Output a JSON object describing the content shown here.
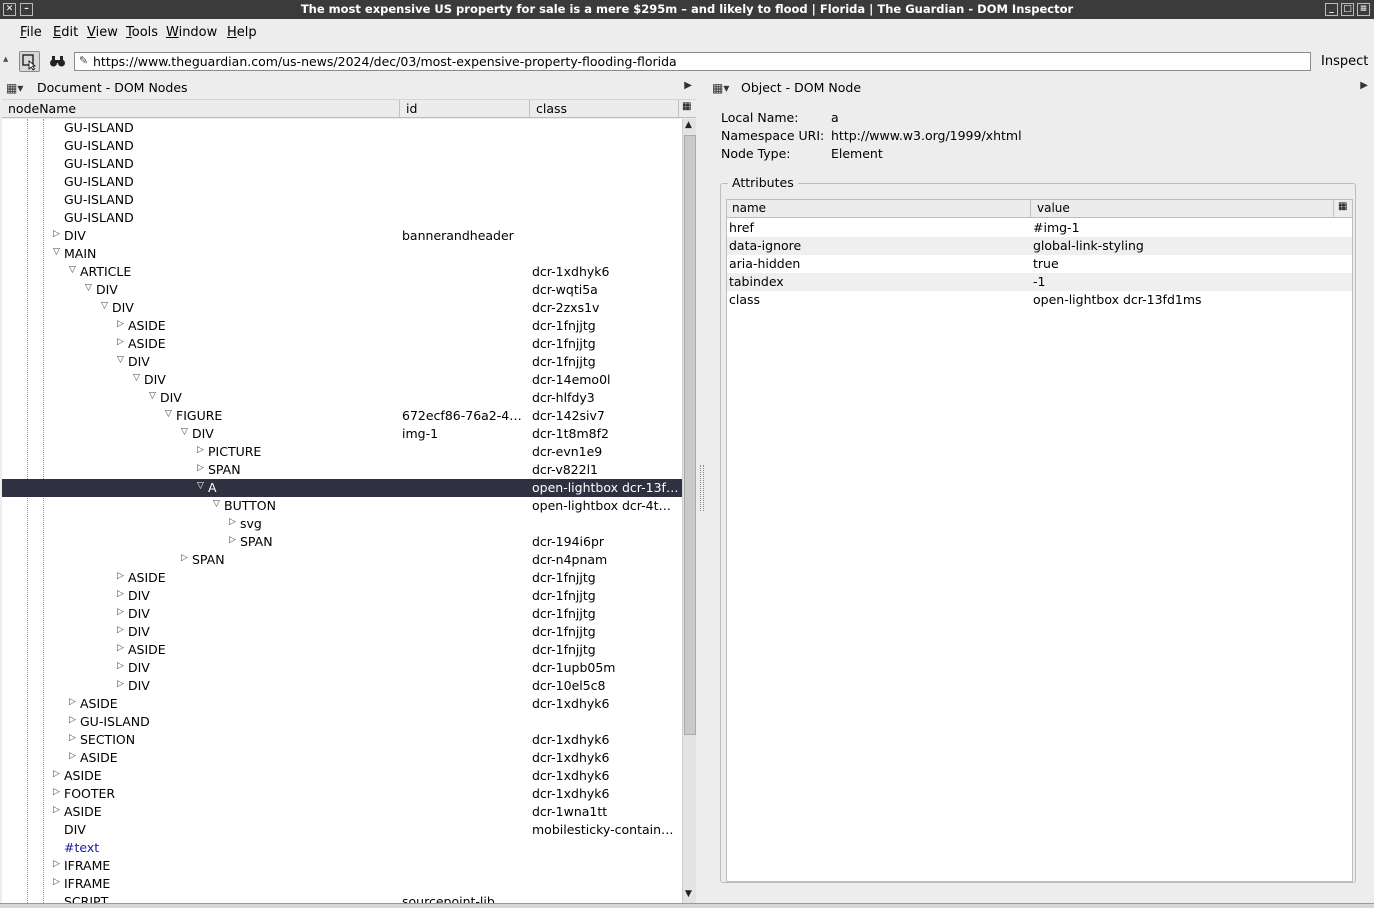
{
  "window": {
    "title": "The most expensive US property for sale is a mere $295m – and likely to flood | Florida | The Guardian - DOM Inspector"
  },
  "menu": [
    {
      "label": "File",
      "u": "F",
      "rest": "ile"
    },
    {
      "label": "Edit",
      "u": "E",
      "rest": "dit"
    },
    {
      "label": "View",
      "u": "V",
      "rest": "iew"
    },
    {
      "label": "Tools",
      "u": "T",
      "rest": "ools"
    },
    {
      "label": "Window",
      "u": "W",
      "rest": "indow"
    },
    {
      "label": "Help",
      "u": "H",
      "rest": "elp"
    }
  ],
  "toolbar": {
    "url": "https://www.theguardian.com/us-news/2024/dec/03/most-expensive-property-flooding-florida",
    "inspect_label": "Inspect"
  },
  "left_panel": {
    "title": "Document - DOM Nodes",
    "columns": {
      "nodename": "nodeName",
      "id": "id",
      "class": "class"
    },
    "rows": [
      {
        "name": "GU-ISLAND",
        "depth": 3,
        "twisty": "none",
        "id": "",
        "cls": ""
      },
      {
        "name": "GU-ISLAND",
        "depth": 3,
        "twisty": "none",
        "id": "",
        "cls": ""
      },
      {
        "name": "GU-ISLAND",
        "depth": 3,
        "twisty": "none",
        "id": "",
        "cls": ""
      },
      {
        "name": "GU-ISLAND",
        "depth": 3,
        "twisty": "none",
        "id": "",
        "cls": ""
      },
      {
        "name": "GU-ISLAND",
        "depth": 3,
        "twisty": "none",
        "id": "",
        "cls": ""
      },
      {
        "name": "GU-ISLAND",
        "depth": 3,
        "twisty": "none",
        "id": "",
        "cls": ""
      },
      {
        "name": "DIV",
        "depth": 3,
        "twisty": "closed",
        "id": "bannerandheader",
        "cls": ""
      },
      {
        "name": "MAIN",
        "depth": 3,
        "twisty": "open",
        "id": "",
        "cls": ""
      },
      {
        "name": "ARTICLE",
        "depth": 4,
        "twisty": "open",
        "id": "",
        "cls": "dcr-1xdhyk6"
      },
      {
        "name": "DIV",
        "depth": 5,
        "twisty": "open",
        "id": "",
        "cls": "dcr-wqti5a"
      },
      {
        "name": "DIV",
        "depth": 6,
        "twisty": "open",
        "id": "",
        "cls": "dcr-2zxs1v"
      },
      {
        "name": "ASIDE",
        "depth": 7,
        "twisty": "closed",
        "id": "",
        "cls": "dcr-1fnjjtg"
      },
      {
        "name": "ASIDE",
        "depth": 7,
        "twisty": "closed",
        "id": "",
        "cls": "dcr-1fnjjtg"
      },
      {
        "name": "DIV",
        "depth": 7,
        "twisty": "open",
        "id": "",
        "cls": "dcr-1fnjjtg"
      },
      {
        "name": "DIV",
        "depth": 8,
        "twisty": "open",
        "id": "",
        "cls": "dcr-14emo0l"
      },
      {
        "name": "DIV",
        "depth": 9,
        "twisty": "open",
        "id": "",
        "cls": "dcr-hlfdy3"
      },
      {
        "name": "FIGURE",
        "depth": 10,
        "twisty": "open",
        "id": "672ecf86-76a2-44…",
        "cls": "dcr-142siv7"
      },
      {
        "name": "DIV",
        "depth": 11,
        "twisty": "open",
        "id": "img-1",
        "cls": "dcr-1t8m8f2"
      },
      {
        "name": "PICTURE",
        "depth": 12,
        "twisty": "closed",
        "id": "",
        "cls": "dcr-evn1e9"
      },
      {
        "name": "SPAN",
        "depth": 12,
        "twisty": "closed",
        "id": "",
        "cls": "dcr-v822l1"
      },
      {
        "name": "A",
        "depth": 12,
        "twisty": "open",
        "id": "",
        "cls": "open-lightbox dcr-13f…",
        "selected": true
      },
      {
        "name": "BUTTON",
        "depth": 13,
        "twisty": "open",
        "id": "",
        "cls": "open-lightbox dcr-4tm…"
      },
      {
        "name": "svg",
        "depth": 14,
        "twisty": "closed",
        "id": "",
        "cls": ""
      },
      {
        "name": "SPAN",
        "depth": 14,
        "twisty": "closed",
        "id": "",
        "cls": "dcr-194i6pr"
      },
      {
        "name": "SPAN",
        "depth": 11,
        "twisty": "closed",
        "id": "",
        "cls": "dcr-n4pnam"
      },
      {
        "name": "ASIDE",
        "depth": 7,
        "twisty": "closed",
        "id": "",
        "cls": "dcr-1fnjjtg"
      },
      {
        "name": "DIV",
        "depth": 7,
        "twisty": "closed",
        "id": "",
        "cls": "dcr-1fnjjtg"
      },
      {
        "name": "DIV",
        "depth": 7,
        "twisty": "closed",
        "id": "",
        "cls": "dcr-1fnjjtg"
      },
      {
        "name": "DIV",
        "depth": 7,
        "twisty": "closed",
        "id": "",
        "cls": "dcr-1fnjjtg"
      },
      {
        "name": "ASIDE",
        "depth": 7,
        "twisty": "closed",
        "id": "",
        "cls": "dcr-1fnjjtg"
      },
      {
        "name": "DIV",
        "depth": 7,
        "twisty": "closed",
        "id": "",
        "cls": "dcr-1upb05m"
      },
      {
        "name": "DIV",
        "depth": 7,
        "twisty": "closed",
        "id": "",
        "cls": "dcr-10el5c8"
      },
      {
        "name": "ASIDE",
        "depth": 4,
        "twisty": "closed",
        "id": "",
        "cls": "dcr-1xdhyk6"
      },
      {
        "name": "GU-ISLAND",
        "depth": 4,
        "twisty": "closed",
        "id": "",
        "cls": ""
      },
      {
        "name": "SECTION",
        "depth": 4,
        "twisty": "closed",
        "id": "",
        "cls": "dcr-1xdhyk6"
      },
      {
        "name": "ASIDE",
        "depth": 4,
        "twisty": "closed",
        "id": "",
        "cls": "dcr-1xdhyk6"
      },
      {
        "name": "ASIDE",
        "depth": 3,
        "twisty": "closed",
        "id": "",
        "cls": "dcr-1xdhyk6"
      },
      {
        "name": "FOOTER",
        "depth": 3,
        "twisty": "closed",
        "id": "",
        "cls": "dcr-1xdhyk6"
      },
      {
        "name": "ASIDE",
        "depth": 3,
        "twisty": "closed",
        "id": "",
        "cls": "dcr-1wna1tt"
      },
      {
        "name": "DIV",
        "depth": 3,
        "twisty": "none",
        "id": "",
        "cls": "mobilesticky-container…"
      },
      {
        "name": "#text",
        "depth": 3,
        "twisty": "none",
        "id": "",
        "cls": "",
        "text": true
      },
      {
        "name": "IFRAME",
        "depth": 3,
        "twisty": "closed",
        "id": "",
        "cls": ""
      },
      {
        "name": "IFRAME",
        "depth": 3,
        "twisty": "closed",
        "id": "",
        "cls": ""
      },
      {
        "name": "SCRIPT",
        "depth": 3,
        "twisty": "none",
        "id": "sourcepoint-lib",
        "cls": ""
      }
    ]
  },
  "right_panel": {
    "title": "Object - DOM Node",
    "local_name_label": "Local Name:",
    "local_name": "a",
    "namespace_label": "Namespace URI:",
    "namespace": "http://www.w3.org/1999/xhtml",
    "node_type_label": "Node Type:",
    "node_type": "Element",
    "attributes_title": "Attributes",
    "attr_columns": {
      "name": "name",
      "value": "value"
    },
    "attributes": [
      {
        "name": "href",
        "value": "#img-1"
      },
      {
        "name": "data-ignore",
        "value": "global-link-styling"
      },
      {
        "name": "aria-hidden",
        "value": "true"
      },
      {
        "name": "tabindex",
        "value": "-1"
      },
      {
        "name": "class",
        "value": "open-lightbox dcr-13fd1ms"
      }
    ]
  },
  "colors": {
    "titlebar": "#3b3b3b",
    "selection": "#2f3140",
    "text_node": "#1a1aa0"
  }
}
